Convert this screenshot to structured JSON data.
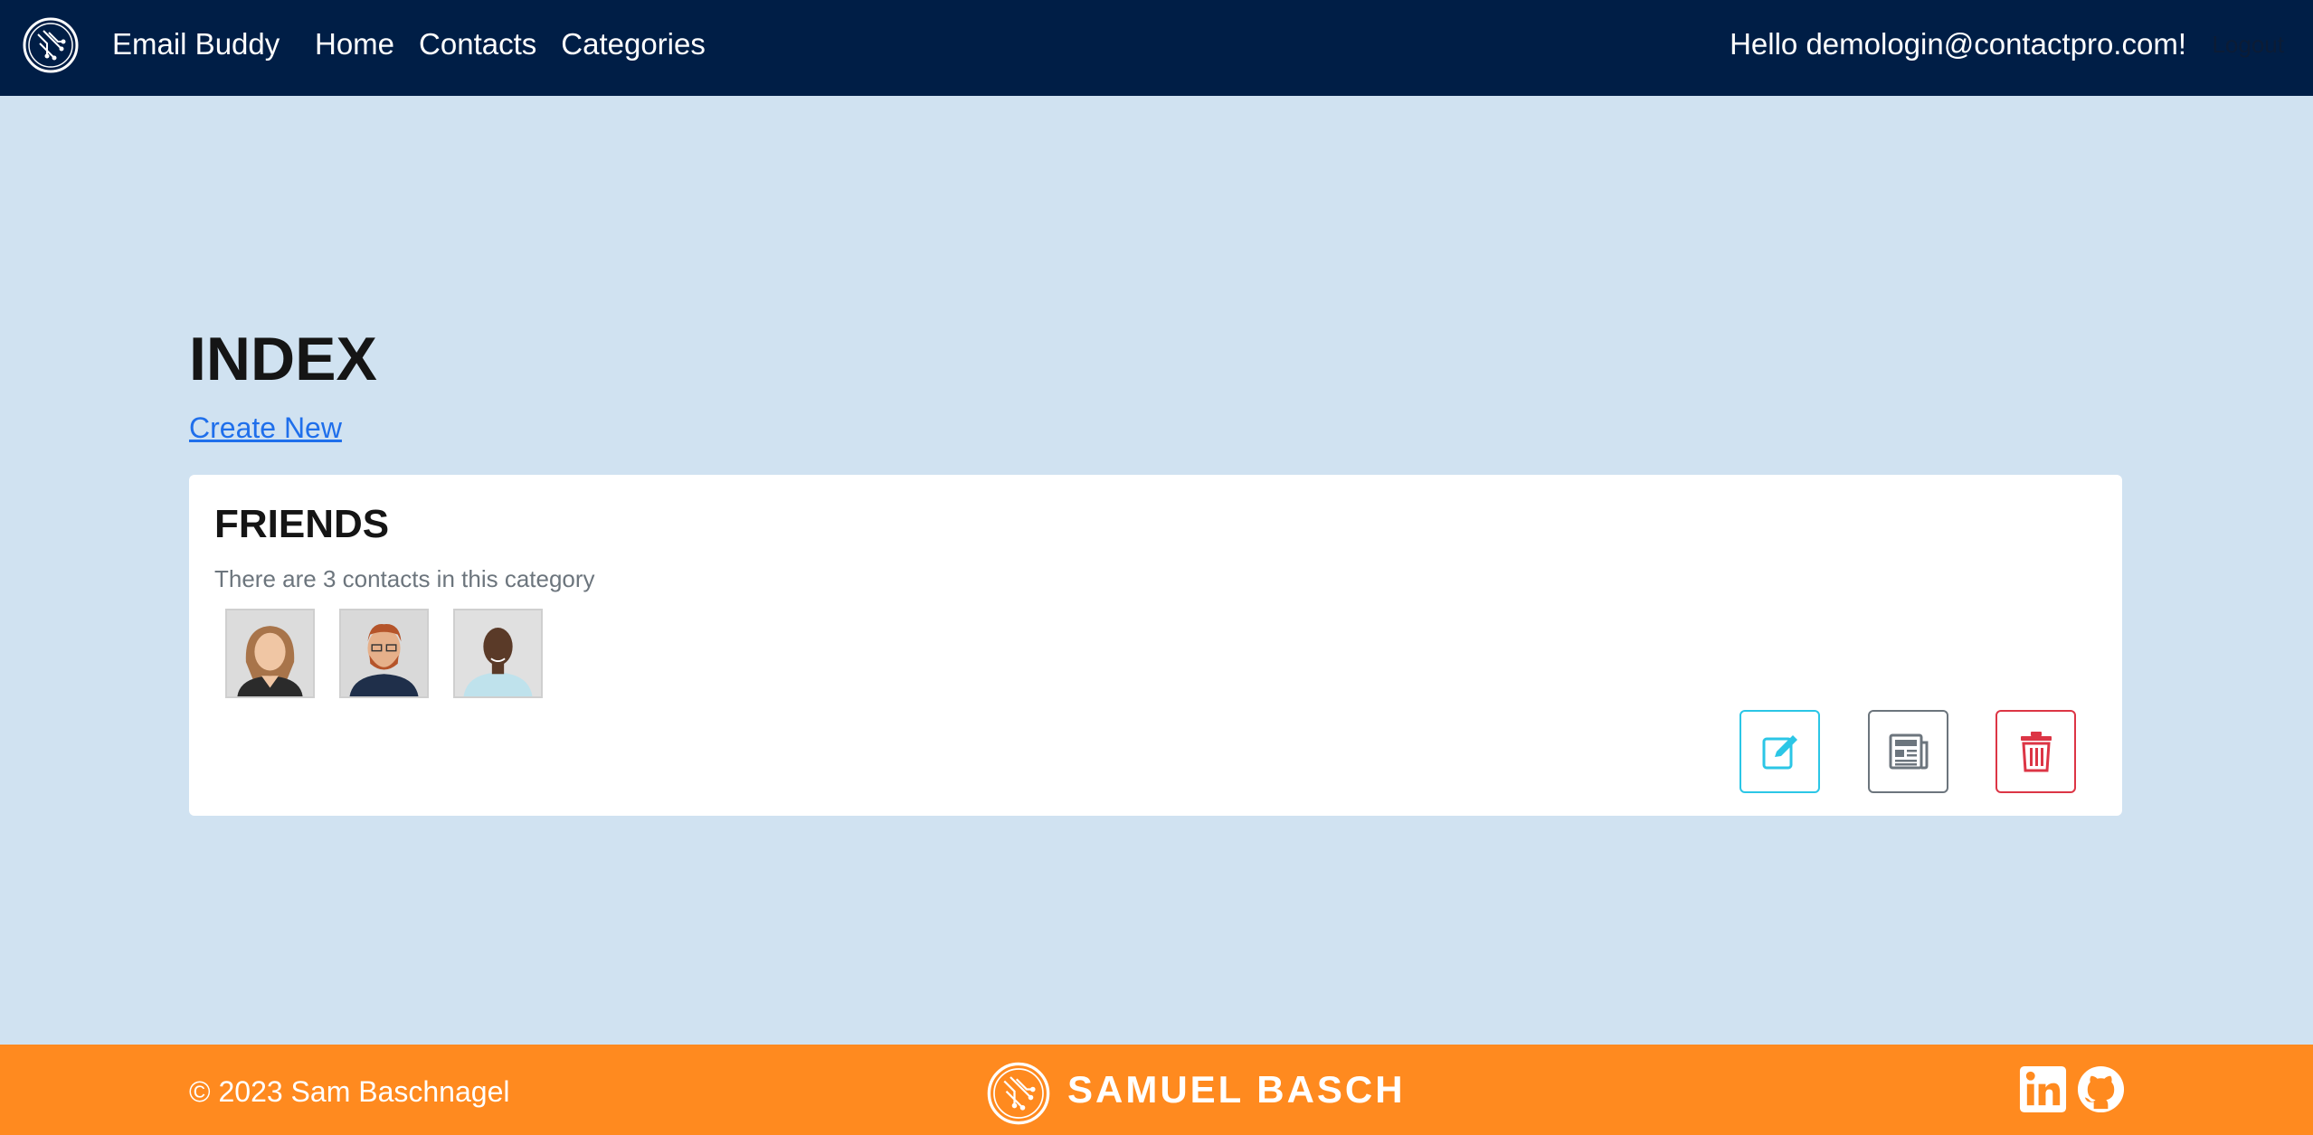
{
  "nav": {
    "brand": "Email Buddy",
    "links": [
      "Home",
      "Contacts",
      "Categories"
    ],
    "hello": "Hello demologin@contactpro.com!",
    "logout": "Logout"
  },
  "main": {
    "title": "INDEX",
    "create_new": "Create New",
    "category": {
      "name": "FRIENDS",
      "summary": "There are 3 contacts in this category",
      "actions": [
        "edit-icon",
        "newspaper-icon",
        "trash-icon"
      ]
    }
  },
  "footer": {
    "copyright": "© 2023 Sam Baschnagel",
    "brand_logo_text": "SAMUEL BASCH",
    "social": [
      "linkedin-icon",
      "github-icon"
    ]
  },
  "colors": {
    "navbar": "#001e46",
    "background": "#d0e2f1",
    "footer": "#ff8a1f",
    "link": "#1f6feb",
    "edit": "#2bc6e6",
    "details": "#6c757d",
    "delete": "#dc3545"
  }
}
